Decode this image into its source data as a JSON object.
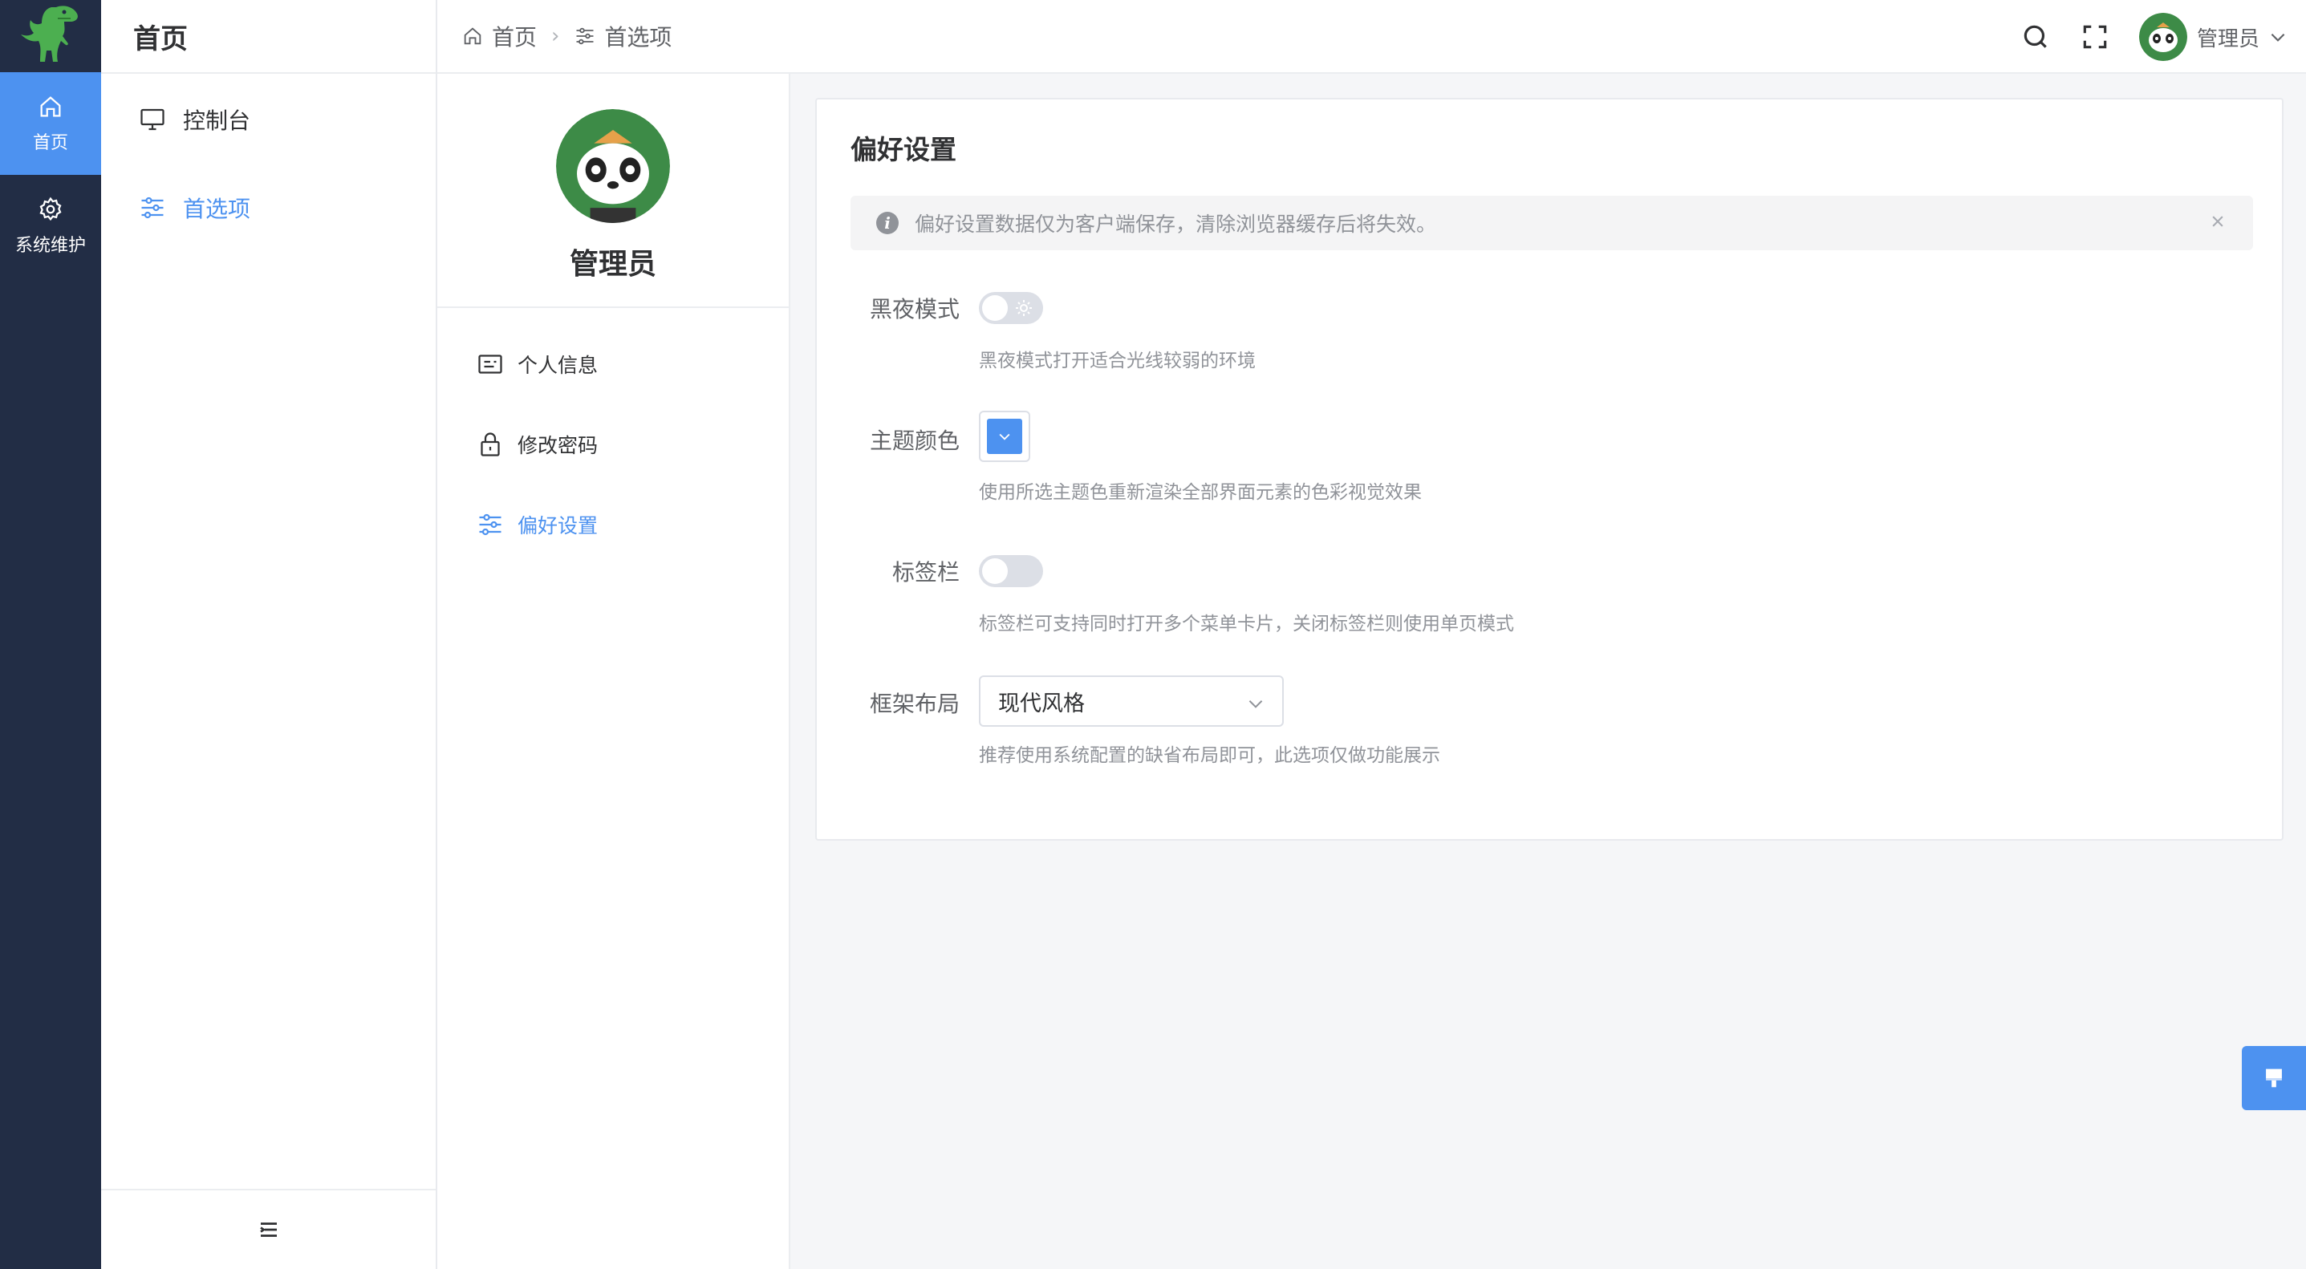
{
  "rail": {
    "items": [
      {
        "label": "首页",
        "icon": "home-icon"
      },
      {
        "label": "系统维护",
        "icon": "gear-icon"
      }
    ]
  },
  "sidebar": {
    "title": "首页",
    "items": [
      {
        "label": "控制台",
        "icon": "monitor-icon"
      },
      {
        "label": "首选项",
        "icon": "sliders-icon"
      }
    ]
  },
  "header": {
    "breadcrumb": [
      {
        "label": "首页",
        "icon": "home-icon"
      },
      {
        "label": "首选项",
        "icon": "sliders-icon"
      }
    ],
    "user_name": "管理员"
  },
  "profile": {
    "name": "管理员",
    "menu": [
      {
        "label": "个人信息",
        "icon": "id-card-icon"
      },
      {
        "label": "修改密码",
        "icon": "lock-icon"
      },
      {
        "label": "偏好设置",
        "icon": "sliders-icon"
      }
    ]
  },
  "settings": {
    "title": "偏好设置",
    "alert": "偏好设置数据仅为客户端保存，清除浏览器缓存后将失效。",
    "dark_mode": {
      "label": "黑夜模式",
      "desc": "黑夜模式打开适合光线较弱的环境",
      "enabled": false
    },
    "theme_color": {
      "label": "主题颜色",
      "desc": "使用所选主题色重新渲染全部界面元素的色彩视觉效果",
      "value": "#4d92f0"
    },
    "tabs_bar": {
      "label": "标签栏",
      "desc": "标签栏可支持同时打开多个菜单卡片，关闭标签栏则使用单页模式",
      "enabled": false
    },
    "layout": {
      "label": "框架布局",
      "value": "现代风格",
      "desc": "推荐使用系统配置的缺省布局即可，此选项仅做功能展示"
    }
  },
  "colors": {
    "accent": "#4d92f0",
    "rail_bg": "#222d45"
  }
}
